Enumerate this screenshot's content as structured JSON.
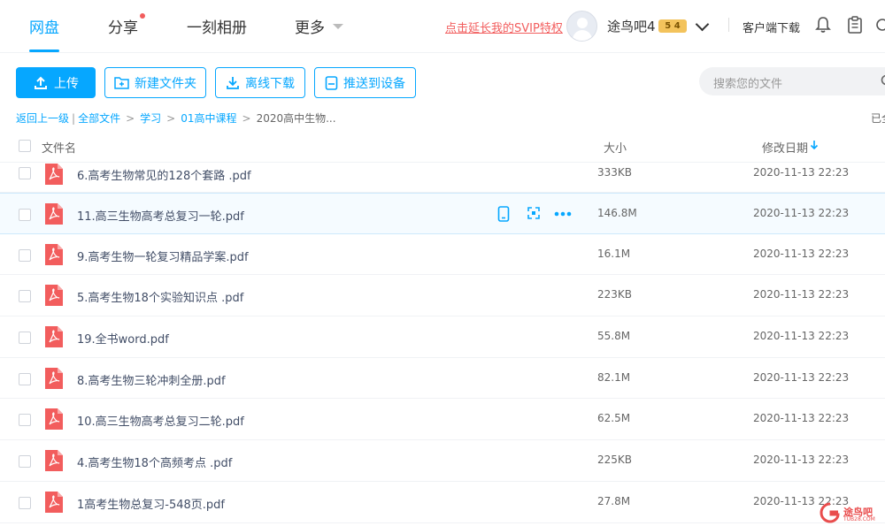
{
  "header": {
    "nav": [
      {
        "label": "网盘",
        "active": true
      },
      {
        "label": "分享",
        "active": false,
        "dot": true
      },
      {
        "label": "一刻相册",
        "active": false
      },
      {
        "label": "更多",
        "active": false,
        "caret": true
      }
    ],
    "svip_link": "点击延长我的SVIP特权",
    "username": "途鸟吧4",
    "vip_badge": "5 4",
    "client_download": "客户端下载"
  },
  "toolbar": {
    "upload": "上传",
    "new_folder": "新建文件夹",
    "offline_download": "离线下载",
    "push_to_device": "推送到设备",
    "search_placeholder": "搜索您的文件"
  },
  "breadcrumb": {
    "back": "返回上一级",
    "all_files": "全部文件",
    "level1": "学习",
    "level2": "01高中课程",
    "current": "2020高中生物...",
    "loaded": "已全"
  },
  "table": {
    "col_name": "文件名",
    "col_size": "大小",
    "col_date": "修改日期",
    "rows": [
      {
        "name": "6.高考生物常见的128个套路 .pdf",
        "size": "333KB",
        "date": "2020-11-13 22:23"
      },
      {
        "name": "11.高三生物高考总复习一轮.pdf",
        "size": "146.8M",
        "date": "2020-11-13 22:23"
      },
      {
        "name": "9.高考生物一轮复习精品学案.pdf",
        "size": "16.1M",
        "date": "2020-11-13 22:23"
      },
      {
        "name": "5.高考生物18个实验知识点 .pdf",
        "size": "223KB",
        "date": "2020-11-13 22:23"
      },
      {
        "name": "19.全书word.pdf",
        "size": "55.8M",
        "date": "2020-11-13 22:23"
      },
      {
        "name": "8.高考生物三轮冲刺全册.pdf",
        "size": "82.1M",
        "date": "2020-11-13 22:23"
      },
      {
        "name": "10.高三生物高考总复习二轮.pdf",
        "size": "62.5M",
        "date": "2020-11-13 22:23"
      },
      {
        "name": "4.高考生物18个高频考点 .pdf",
        "size": "225KB",
        "date": "2020-11-13 22:23"
      },
      {
        "name": "1高考生物总复习-548页.pdf",
        "size": "27.8M",
        "date": "2020-11-13 22:23"
      }
    ]
  },
  "watermark": {
    "text": "途鸟吧",
    "sub": "TUB28.COM"
  },
  "colors": {
    "accent": "#06a7ff",
    "pdf_red": "#f25d5d",
    "link_red": "#f25d5d"
  }
}
